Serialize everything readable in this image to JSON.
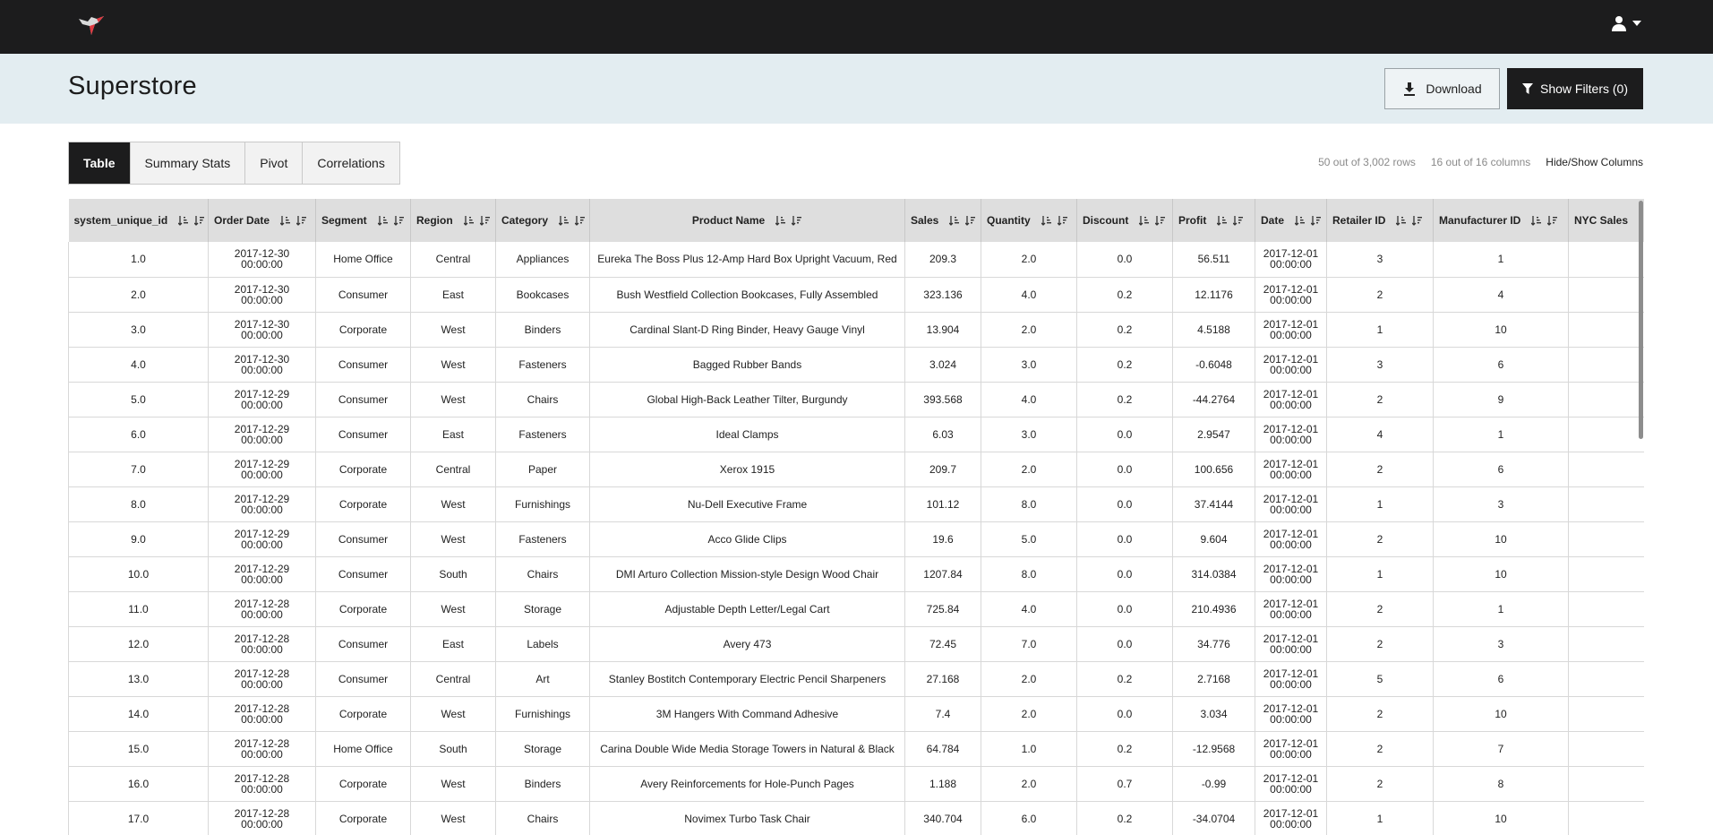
{
  "app": {
    "title": "Superstore"
  },
  "topbar": {
    "logo_icon": "hummingbird-logo-icon",
    "user_icon": "user-icon",
    "caret_icon": "caret-down-icon"
  },
  "header": {
    "title": "Superstore",
    "download_label": "Download",
    "filters_label": "Show Filters (0)"
  },
  "tabs": [
    {
      "label": "Table",
      "active": true
    },
    {
      "label": "Summary Stats",
      "active": false
    },
    {
      "label": "Pivot",
      "active": false
    },
    {
      "label": "Correlations",
      "active": false
    }
  ],
  "meta": {
    "rows": "50 out of 3,002 rows",
    "columns": "16 out of 16 columns",
    "hide_show": "Hide/Show Columns"
  },
  "table": {
    "columns": [
      "system_unique_id",
      "Order Date",
      "Segment",
      "Region",
      "Category",
      "Product Name",
      "Sales",
      "Quantity",
      "Discount",
      "Profit",
      "Date",
      "Retailer ID",
      "Manufacturer ID",
      "NYC Sales"
    ],
    "rows": [
      [
        "1.0",
        "2017-12-30 00:00:00",
        "Home Office",
        "Central",
        "Appliances",
        "Eureka The Boss Plus 12-Amp Hard Box Upright Vacuum, Red",
        "209.3",
        "2.0",
        "0.0",
        "56.511",
        "2017-12-01 00:00:00",
        "3",
        "1",
        ""
      ],
      [
        "2.0",
        "2017-12-30 00:00:00",
        "Consumer",
        "East",
        "Bookcases",
        "Bush Westfield Collection Bookcases, Fully Assembled",
        "323.136",
        "4.0",
        "0.2",
        "12.1176",
        "2017-12-01 00:00:00",
        "2",
        "4",
        ""
      ],
      [
        "3.0",
        "2017-12-30 00:00:00",
        "Corporate",
        "West",
        "Binders",
        "Cardinal Slant-D Ring Binder, Heavy Gauge Vinyl",
        "13.904",
        "2.0",
        "0.2",
        "4.5188",
        "2017-12-01 00:00:00",
        "1",
        "10",
        ""
      ],
      [
        "4.0",
        "2017-12-30 00:00:00",
        "Consumer",
        "West",
        "Fasteners",
        "Bagged Rubber Bands",
        "3.024",
        "3.0",
        "0.2",
        "-0.6048",
        "2017-12-01 00:00:00",
        "3",
        "6",
        ""
      ],
      [
        "5.0",
        "2017-12-29 00:00:00",
        "Consumer",
        "West",
        "Chairs",
        "Global High-Back Leather Tilter, Burgundy",
        "393.568",
        "4.0",
        "0.2",
        "-44.2764",
        "2017-12-01 00:00:00",
        "2",
        "9",
        ""
      ],
      [
        "6.0",
        "2017-12-29 00:00:00",
        "Consumer",
        "East",
        "Fasteners",
        "Ideal Clamps",
        "6.03",
        "3.0",
        "0.0",
        "2.9547",
        "2017-12-01 00:00:00",
        "4",
        "1",
        ""
      ],
      [
        "7.0",
        "2017-12-29 00:00:00",
        "Corporate",
        "Central",
        "Paper",
        "Xerox 1915",
        "209.7",
        "2.0",
        "0.0",
        "100.656",
        "2017-12-01 00:00:00",
        "2",
        "6",
        ""
      ],
      [
        "8.0",
        "2017-12-29 00:00:00",
        "Corporate",
        "West",
        "Furnishings",
        "Nu-Dell Executive Frame",
        "101.12",
        "8.0",
        "0.0",
        "37.4144",
        "2017-12-01 00:00:00",
        "1",
        "3",
        ""
      ],
      [
        "9.0",
        "2017-12-29 00:00:00",
        "Consumer",
        "West",
        "Fasteners",
        "Acco Glide Clips",
        "19.6",
        "5.0",
        "0.0",
        "9.604",
        "2017-12-01 00:00:00",
        "2",
        "10",
        ""
      ],
      [
        "10.0",
        "2017-12-29 00:00:00",
        "Consumer",
        "South",
        "Chairs",
        "DMI Arturo Collection Mission-style Design Wood Chair",
        "1207.84",
        "8.0",
        "0.0",
        "314.0384",
        "2017-12-01 00:00:00",
        "1",
        "10",
        ""
      ],
      [
        "11.0",
        "2017-12-28 00:00:00",
        "Corporate",
        "West",
        "Storage",
        "Adjustable Depth Letter/Legal Cart",
        "725.84",
        "4.0",
        "0.0",
        "210.4936",
        "2017-12-01 00:00:00",
        "2",
        "1",
        ""
      ],
      [
        "12.0",
        "2017-12-28 00:00:00",
        "Consumer",
        "East",
        "Labels",
        "Avery 473",
        "72.45",
        "7.0",
        "0.0",
        "34.776",
        "2017-12-01 00:00:00",
        "2",
        "3",
        ""
      ],
      [
        "13.0",
        "2017-12-28 00:00:00",
        "Consumer",
        "Central",
        "Art",
        "Stanley Bostitch Contemporary Electric Pencil Sharpeners",
        "27.168",
        "2.0",
        "0.2",
        "2.7168",
        "2017-12-01 00:00:00",
        "5",
        "6",
        ""
      ],
      [
        "14.0",
        "2017-12-28 00:00:00",
        "Corporate",
        "West",
        "Furnishings",
        "3M Hangers With Command Adhesive",
        "7.4",
        "2.0",
        "0.0",
        "3.034",
        "2017-12-01 00:00:00",
        "2",
        "10",
        ""
      ],
      [
        "15.0",
        "2017-12-28 00:00:00",
        "Home Office",
        "South",
        "Storage",
        "Carina Double Wide Media Storage Towers in Natural & Black",
        "64.784",
        "1.0",
        "0.2",
        "-12.9568",
        "2017-12-01 00:00:00",
        "2",
        "7",
        ""
      ],
      [
        "16.0",
        "2017-12-28 00:00:00",
        "Corporate",
        "West",
        "Binders",
        "Avery Reinforcements for Hole-Punch Pages",
        "1.188",
        "2.0",
        "0.7",
        "-0.99",
        "2017-12-01 00:00:00",
        "2",
        "8",
        ""
      ],
      [
        "17.0",
        "2017-12-28 00:00:00",
        "Corporate",
        "West",
        "Chairs",
        "Novimex Turbo Task Chair",
        "340.704",
        "6.0",
        "0.2",
        "-34.0704",
        "2017-12-01 00:00:00",
        "1",
        "10",
        ""
      ]
    ]
  },
  "colors": {
    "topbar": "#1c1c1d",
    "header_bg": "#e3edf1",
    "table_header_bg": "#dedede",
    "active_tab": "#1c1c1d"
  }
}
